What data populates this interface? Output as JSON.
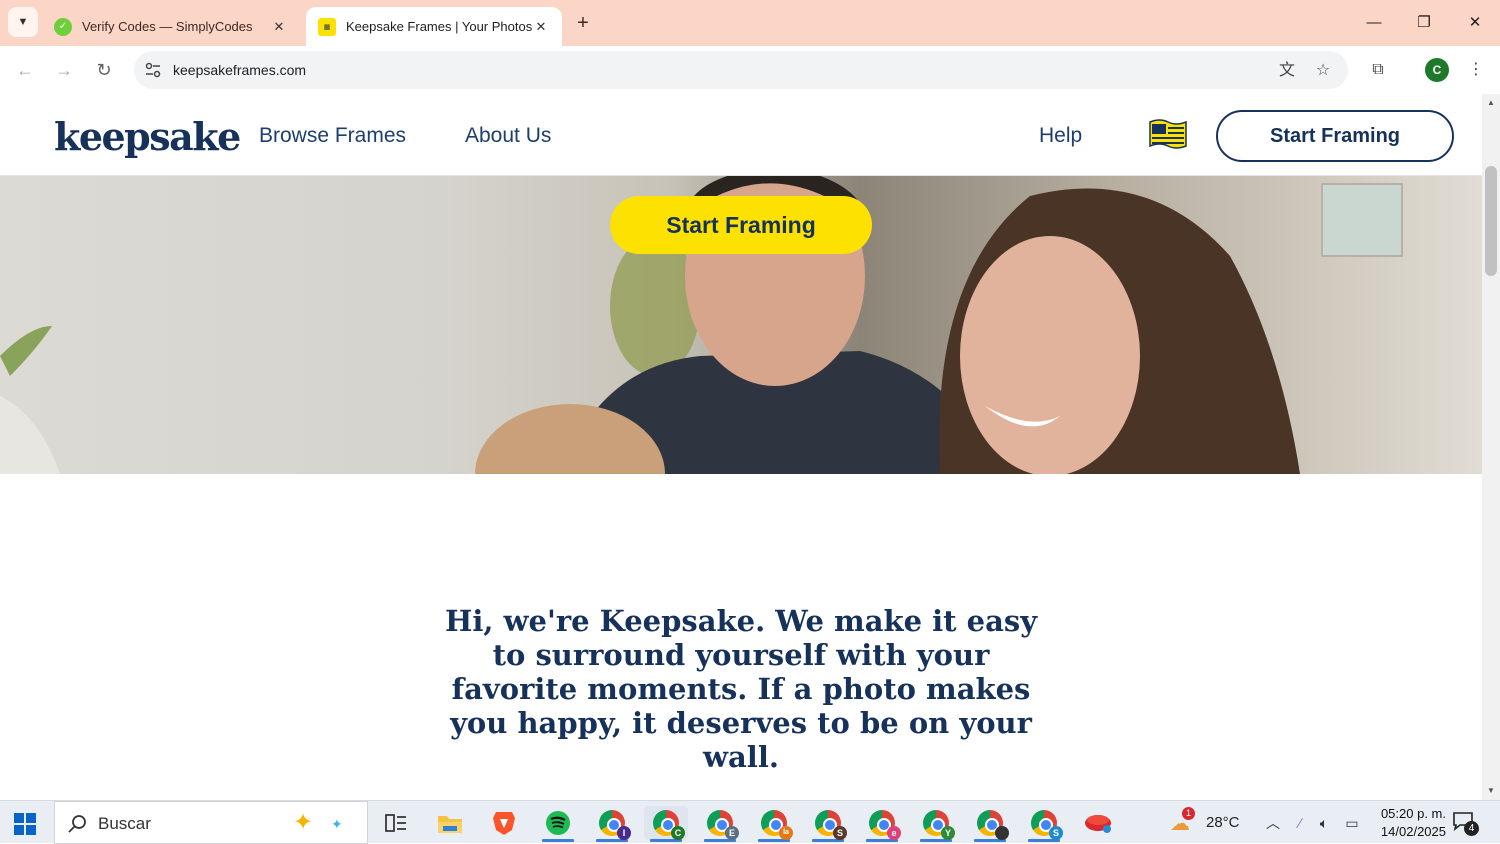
{
  "browser": {
    "tabs": [
      {
        "title": "Verify Codes — SimplyCodes",
        "active": false
      },
      {
        "title": "Keepsake Frames | Your Photos",
        "active": true
      }
    ],
    "url": "keepsakeframes.com",
    "profile_initial": "C"
  },
  "site": {
    "logo": "keepsake",
    "nav": {
      "browse": "Browse Frames",
      "about": "About Us",
      "help": "Help",
      "cta": "Start Framing"
    },
    "hero": {
      "cta": "Start Framing"
    },
    "intro": "Hi, we're Keepsake. We make it easy to surround yourself with your favorite moments. If a photo makes you happy, it deserves to be on your wall."
  },
  "taskbar": {
    "search_placeholder": "Buscar",
    "weather": "28°C",
    "weather_badge": "1",
    "time": "05:20 p. m.",
    "date": "14/02/2025",
    "notifications": "4",
    "chrome_profiles": [
      "I",
      "C",
      "E",
      "la",
      "S",
      "e",
      "Y",
      "",
      "S"
    ]
  },
  "colors": {
    "brand_navy": "#16325a",
    "brand_yellow": "#fde100",
    "tabstrip": "#fbd5c6"
  }
}
